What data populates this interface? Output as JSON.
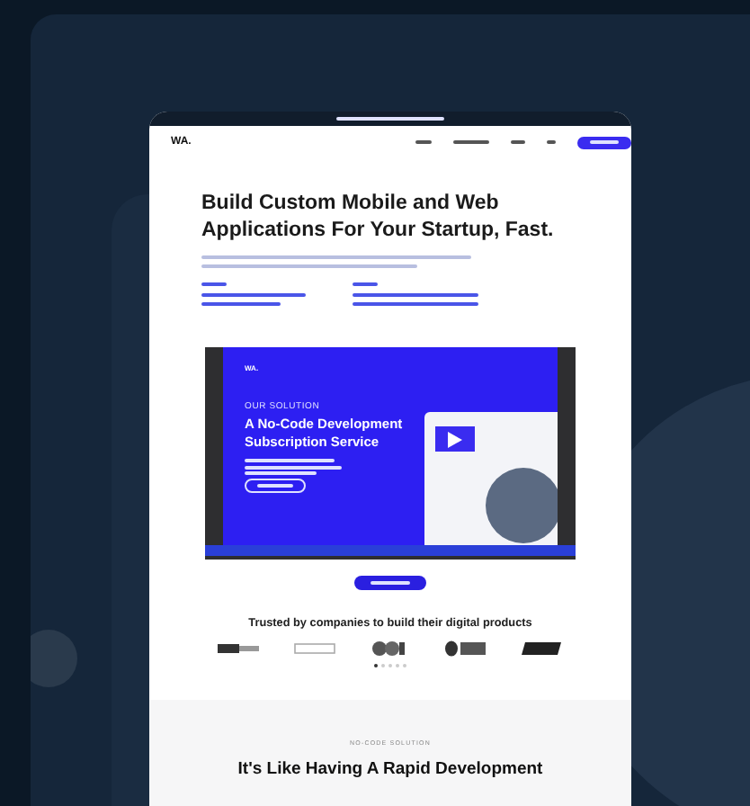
{
  "site": {
    "logo": "WA.",
    "hero": {
      "title_lines": [
        "Build Custom Mobile and Web",
        "Applications For Your Startup, Fast."
      ]
    },
    "video": {
      "logo": "WA.",
      "eyebrow": "OUR SOLUTION",
      "title_lines": [
        "A No-Code Development",
        "Subscription Service"
      ]
    },
    "trusted": {
      "heading": "Trusted by companies to build their digital products",
      "logos": [
        {
          "kind": "wordmark"
        },
        {
          "kind": "outline"
        },
        {
          "kind": "circles"
        },
        {
          "kind": "utp"
        },
        {
          "kind": "bold"
        }
      ],
      "dots": [
        {
          "selected": true
        },
        {
          "selected": false
        },
        {
          "selected": false
        },
        {
          "selected": false
        },
        {
          "selected": false
        }
      ]
    },
    "section": {
      "eyebrow": "NO-CODE SOLUTION",
      "title": "It's Like Having A Rapid Development"
    }
  }
}
